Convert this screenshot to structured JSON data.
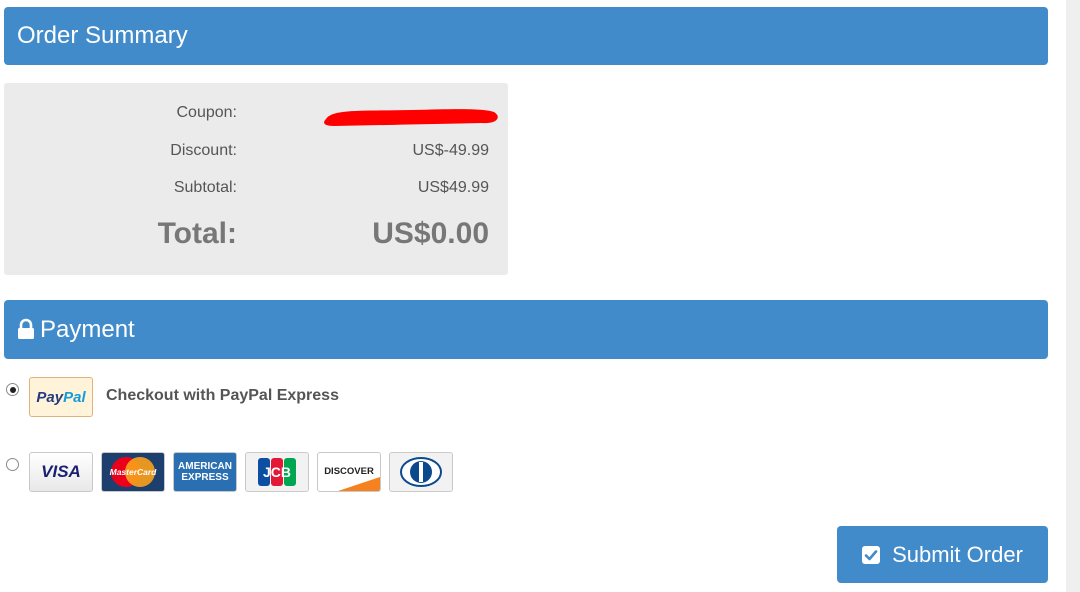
{
  "order_summary": {
    "title": "Order Summary",
    "rows": [
      {
        "label": "Coupon:",
        "value": ""
      },
      {
        "label": "Discount:",
        "value": "US$-49.99"
      },
      {
        "label": "Subtotal:",
        "value": "US$49.99"
      }
    ],
    "total_label": "Total:",
    "total_value": "US$0.00"
  },
  "payment": {
    "title": "Payment",
    "paypal_option": {
      "selected": true,
      "logo_text_1": "Pay",
      "logo_text_2": "Pal",
      "label": "Checkout with PayPal Express"
    },
    "card_option": {
      "selected": false,
      "cards": [
        {
          "icon": "visa-icon",
          "text": "VISA"
        },
        {
          "icon": "mastercard-icon",
          "text": "MasterCard"
        },
        {
          "icon": "amex-icon",
          "text_1": "AMERICAN",
          "text_2": "EXPRESS"
        },
        {
          "icon": "jcb-icon",
          "text": "JCB"
        },
        {
          "icon": "discover-icon",
          "text": "DISCOVER"
        },
        {
          "icon": "diners-club-icon"
        }
      ]
    }
  },
  "submit_label": "Submit Order",
  "colors": {
    "accent": "#428bca",
    "summary_bg": "#ebebeb",
    "redaction": "#ff0000"
  }
}
